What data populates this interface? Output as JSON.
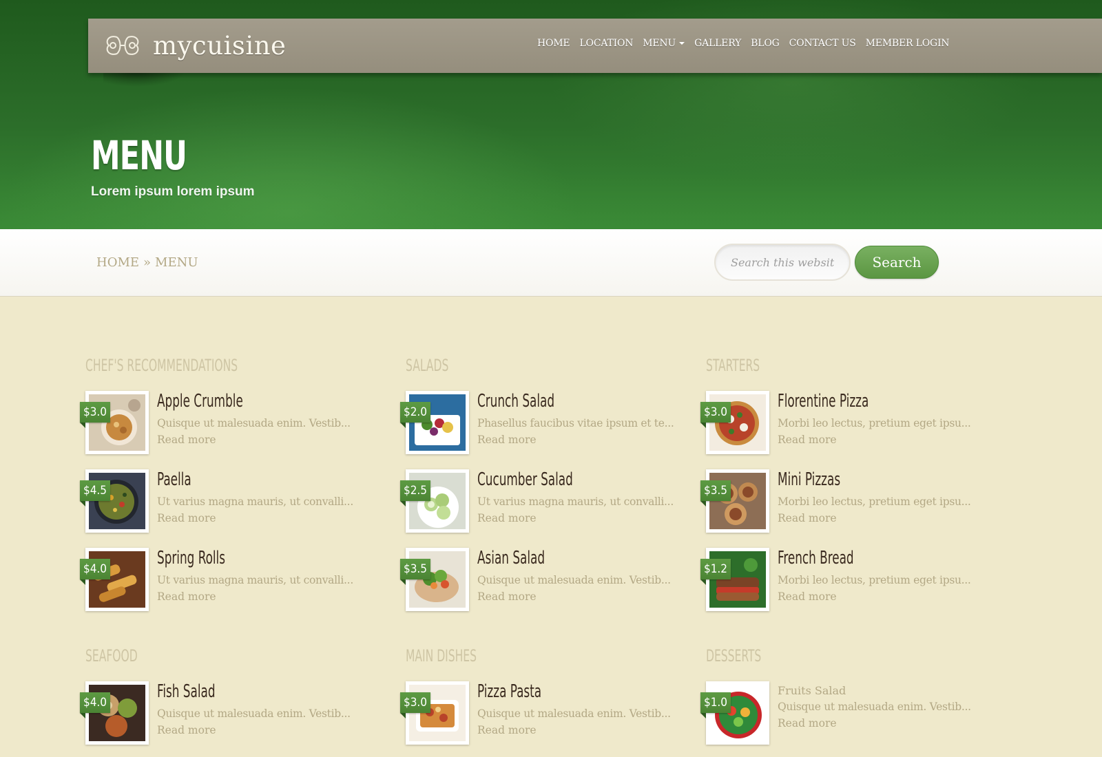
{
  "brand": {
    "name": "mycuisine"
  },
  "nav": [
    {
      "label": "HOME"
    },
    {
      "label": "LOCATION"
    },
    {
      "label": "MENU",
      "dropdown": true
    },
    {
      "label": "GALLERY"
    },
    {
      "label": "BLOG"
    },
    {
      "label": "CONTACT US"
    },
    {
      "label": "MEMBER LOGIN"
    }
  ],
  "hero": {
    "title": "MENU",
    "subtitle": "Lorem ipsum lorem ipsum"
  },
  "breadcrumb": {
    "home": "HOME",
    "separator": "»",
    "current": "MENU"
  },
  "search": {
    "placeholder": "Search this website...",
    "button_label": "Search"
  },
  "colors": {
    "accent": "#5d9b43",
    "nav_bg": "#9b9484",
    "hero_green": "#2c6e2a",
    "page_bg": "#efe9cb",
    "muted_text": "#b3a885",
    "item_title": "#3a2a1f"
  },
  "categories": [
    {
      "title": "CHEF'S RECOMMENDATIONS",
      "items": [
        {
          "price": "$3.0",
          "name": "Apple Crumble",
          "desc": "Quisque ut malesuada enim. Vestib...",
          "more": "Read more",
          "image": "apple-crumble"
        },
        {
          "price": "$4.5",
          "name": "Paella",
          "desc": "Ut varius magna mauris, ut convalli...",
          "more": "Read more",
          "image": "paella"
        },
        {
          "price": "$4.0",
          "name": "Spring Rolls",
          "desc": "Ut varius magna mauris, ut convalli...",
          "more": "Read more",
          "image": "spring-rolls"
        }
      ]
    },
    {
      "title": "SALADS",
      "items": [
        {
          "price": "$2.0",
          "name": "Crunch Salad",
          "desc": "Phasellus faucibus vitae ipsum et te...",
          "more": "Read more",
          "image": "crunch-salad"
        },
        {
          "price": "$2.5",
          "name": "Cucumber Salad",
          "desc": "Ut varius magna mauris, ut convalli...",
          "more": "Read more",
          "image": "cucumber-salad"
        },
        {
          "price": "$3.5",
          "name": "Asian Salad",
          "desc": "Quisque ut malesuada enim. Vestib...",
          "more": "Read more",
          "image": "asian-salad"
        }
      ]
    },
    {
      "title": "STARTERS",
      "items": [
        {
          "price": "$3.0",
          "name": "Florentine Pizza",
          "desc": "Morbi leo lectus, pretium eget ipsu...",
          "more": "Read more",
          "image": "florentine-pizza"
        },
        {
          "price": "$3.5",
          "name": "Mini Pizzas",
          "desc": "Morbi leo lectus, pretium eget ipsu...",
          "more": "Read more",
          "image": "mini-pizzas"
        },
        {
          "price": "$1.2",
          "name": "French Bread",
          "desc": "Morbi leo lectus, pretium eget ipsu...",
          "more": "Read more",
          "image": "french-bread"
        }
      ]
    },
    {
      "title": "SEAFOOD",
      "items": [
        {
          "price": "$4.0",
          "name": "Fish Salad",
          "desc": "Quisque ut malesuada enim. Vestib...",
          "more": "Read more",
          "image": "fish-salad"
        }
      ]
    },
    {
      "title": "MAIN DISHES",
      "items": [
        {
          "price": "$3.0",
          "name": "Pizza Pasta",
          "desc": "Quisque ut malesuada enim. Vestib...",
          "more": "Read more",
          "image": "pizza-pasta"
        }
      ]
    },
    {
      "title": "DESSERTS",
      "items": [
        {
          "price": "$1.0",
          "name": "Fruits Salad",
          "desc": "Quisque ut malesuada enim. Vestib...",
          "more": "Read more",
          "image": "fruits-salad",
          "plain": true
        }
      ]
    }
  ]
}
